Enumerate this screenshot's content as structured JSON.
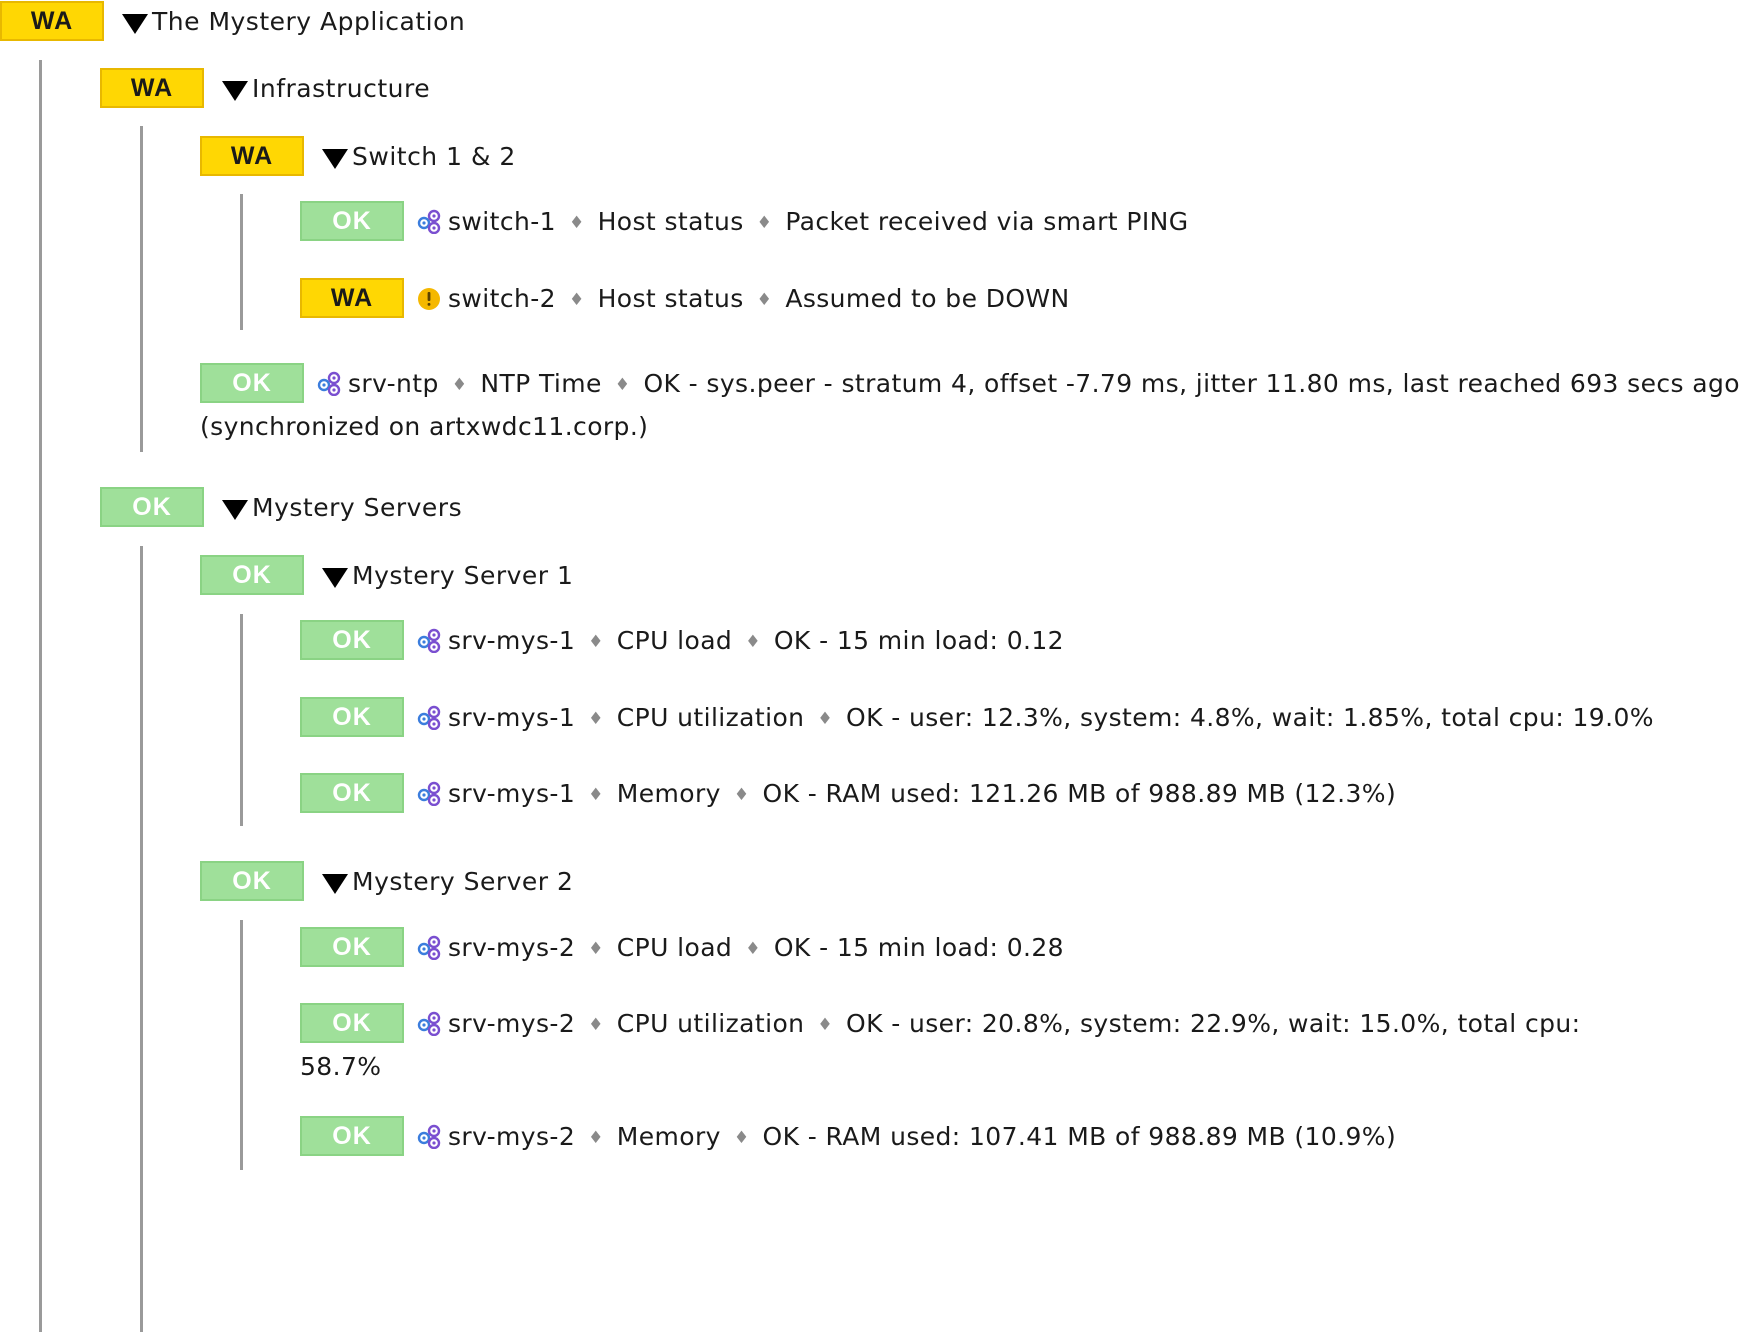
{
  "colors": {
    "warn_bg": "#ffd703",
    "ok_bg": "#9fe09a",
    "tree_line": "#9a9a9a",
    "alert_icon": "#f5b800"
  },
  "separator": "♦",
  "root": {
    "state": "WA",
    "title": "The Mystery Application"
  },
  "infrastructure": {
    "state": "WA",
    "title": "Infrastructure",
    "switches": {
      "state": "WA",
      "title": "Switch 1 & 2",
      "items": [
        {
          "state": "OK",
          "host": "switch-1",
          "service": "Host status",
          "output": "Packet received via smart PING"
        },
        {
          "state": "WA",
          "host": "switch-2",
          "service": "Host status",
          "output": "Assumed to be DOWN"
        }
      ]
    },
    "ntp": {
      "state": "OK",
      "host": "srv-ntp",
      "service": "NTP Time",
      "output": "OK - sys.peer - stratum 4, offset -7.79 ms, jitter 11.80 ms, last reached 693 secs ago (synchronized on artxwdc11.corp.)"
    }
  },
  "servers": {
    "state": "OK",
    "title": "Mystery Servers",
    "server1": {
      "state": "OK",
      "title": "Mystery Server 1",
      "items": [
        {
          "state": "OK",
          "host": "srv-mys-1",
          "service": "CPU load",
          "output": "OK - 15 min load: 0.12"
        },
        {
          "state": "OK",
          "host": "srv-mys-1",
          "service": "CPU utilization",
          "output": "OK - user: 12.3%, system: 4.8%, wait: 1.85%, total cpu: 19.0%"
        },
        {
          "state": "OK",
          "host": "srv-mys-1",
          "service": "Memory",
          "output": "OK - RAM used: 121.26 MB of 988.89 MB (12.3%)"
        }
      ]
    },
    "server2": {
      "state": "OK",
      "title": "Mystery Server 2",
      "items": [
        {
          "state": "OK",
          "host": "srv-mys-2",
          "service": "CPU load",
          "output": "OK - 15 min load: 0.28"
        },
        {
          "state": "OK",
          "host": "srv-mys-2",
          "service": "CPU utilization",
          "output": "OK - user: 20.8%, system: 22.9%, wait: 15.0%, total cpu: 58.7%"
        },
        {
          "state": "OK",
          "host": "srv-mys-2",
          "service": "Memory",
          "output": "OK - RAM used: 107.41 MB of 988.89 MB (10.9%)"
        }
      ]
    }
  }
}
